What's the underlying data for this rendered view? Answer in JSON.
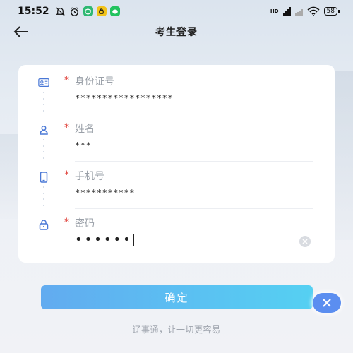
{
  "status_bar": {
    "time": "15:52",
    "network_label": "HD",
    "battery": "58"
  },
  "header": {
    "title": "考生登录"
  },
  "form": {
    "fields": [
      {
        "name": "id-number",
        "icon": "id-card-icon",
        "required_mark": "*",
        "label": "身份证号",
        "value": "******************"
      },
      {
        "name": "name",
        "icon": "user-icon",
        "required_mark": "*",
        "label": "姓名",
        "value": "***"
      },
      {
        "name": "phone",
        "icon": "phone-icon",
        "required_mark": "*",
        "label": "手机号",
        "value": "***********"
      },
      {
        "name": "password",
        "icon": "lock-icon",
        "required_mark": "*",
        "label": "密码",
        "value": "••••••"
      }
    ]
  },
  "actions": {
    "confirm_label": "确定"
  },
  "footer": {
    "slogan": "辽事通，让一切更容易"
  },
  "colors": {
    "accent": "#5b8ef0",
    "button_gradient_start": "#62abf0",
    "button_gradient_end": "#55d0f2",
    "required": "#e0413a",
    "label": "#9aa0a8"
  }
}
